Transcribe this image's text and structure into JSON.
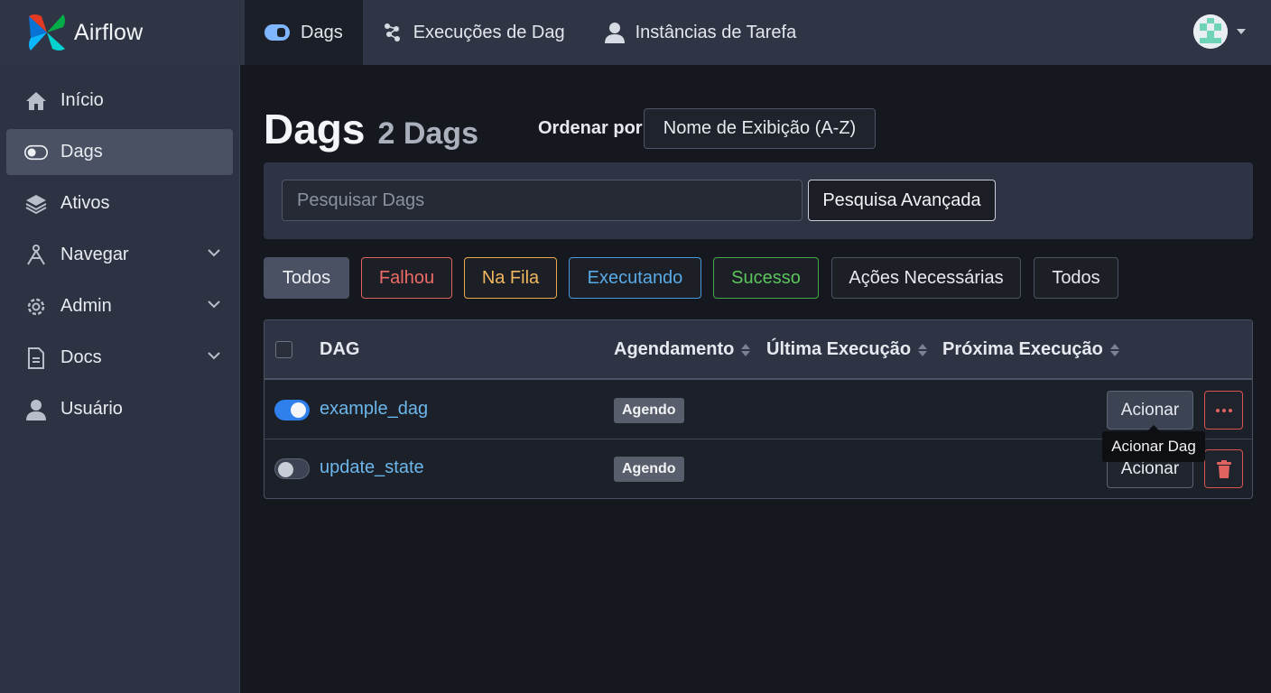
{
  "app": {
    "brand_name": "Airflow"
  },
  "topnav": {
    "tabs": [
      {
        "label": "Dags",
        "icon": "toggle-icon",
        "active": true
      },
      {
        "label": "Execuções de Dag",
        "icon": "dag-runs-icon",
        "active": false
      },
      {
        "label": "Instâncias de Tarefa",
        "icon": "user-task-icon",
        "active": false
      }
    ]
  },
  "sidebar": {
    "items": [
      {
        "label": "Início",
        "icon": "home-icon",
        "active": false,
        "has_submenu": false
      },
      {
        "label": "Dags",
        "icon": "toggle-icon",
        "active": true,
        "has_submenu": false
      },
      {
        "label": "Ativos",
        "icon": "layers-icon",
        "active": false,
        "has_submenu": false
      },
      {
        "label": "Navegar",
        "icon": "network-icon",
        "active": false,
        "has_submenu": true
      },
      {
        "label": "Admin",
        "icon": "gear-icon",
        "active": false,
        "has_submenu": true
      },
      {
        "label": "Docs",
        "icon": "document-icon",
        "active": false,
        "has_submenu": true
      },
      {
        "label": "Usuário",
        "icon": "user-icon",
        "active": false,
        "has_submenu": false
      }
    ]
  },
  "main": {
    "title": "Dags",
    "count": "2 Dags",
    "sort_label": "Ordenar por",
    "sort_value": "Nome de Exibição (A-Z)",
    "search": {
      "placeholder": "Pesquisar Dags",
      "advanced_label": "Pesquisa Avançada"
    },
    "filters": [
      {
        "label": "Todos",
        "state": "active"
      },
      {
        "label": "Falhou",
        "state": "failed",
        "color": "#ef6b66"
      },
      {
        "label": "Na Fila",
        "state": "queued",
        "color": "#f0b85e"
      },
      {
        "label": "Executando",
        "state": "running",
        "color": "#5aaae6"
      },
      {
        "label": "Sucesso",
        "state": "success",
        "color": "#5cc45c"
      },
      {
        "label": "Ações Necessárias",
        "state": "default"
      },
      {
        "label": "Todos",
        "state": "default"
      }
    ],
    "table": {
      "headers": {
        "dag": "DAG",
        "schedule": "Agendamento",
        "last_run": "Última Execução",
        "next_run": "Próxima Execução"
      },
      "rows": [
        {
          "name": "example_dag",
          "enabled": true,
          "schedule": "Agendo",
          "trigger_label": "Acionar",
          "action": "more-icon"
        },
        {
          "name": "update_state",
          "enabled": false,
          "schedule": "Agendo",
          "trigger_label": "Acionar",
          "action": "trash-icon"
        }
      ]
    },
    "tooltip": "Acionar Dag"
  },
  "colors": {
    "accent": "#2f80ed",
    "link": "#6cb7ec",
    "danger": "#d9534f"
  }
}
